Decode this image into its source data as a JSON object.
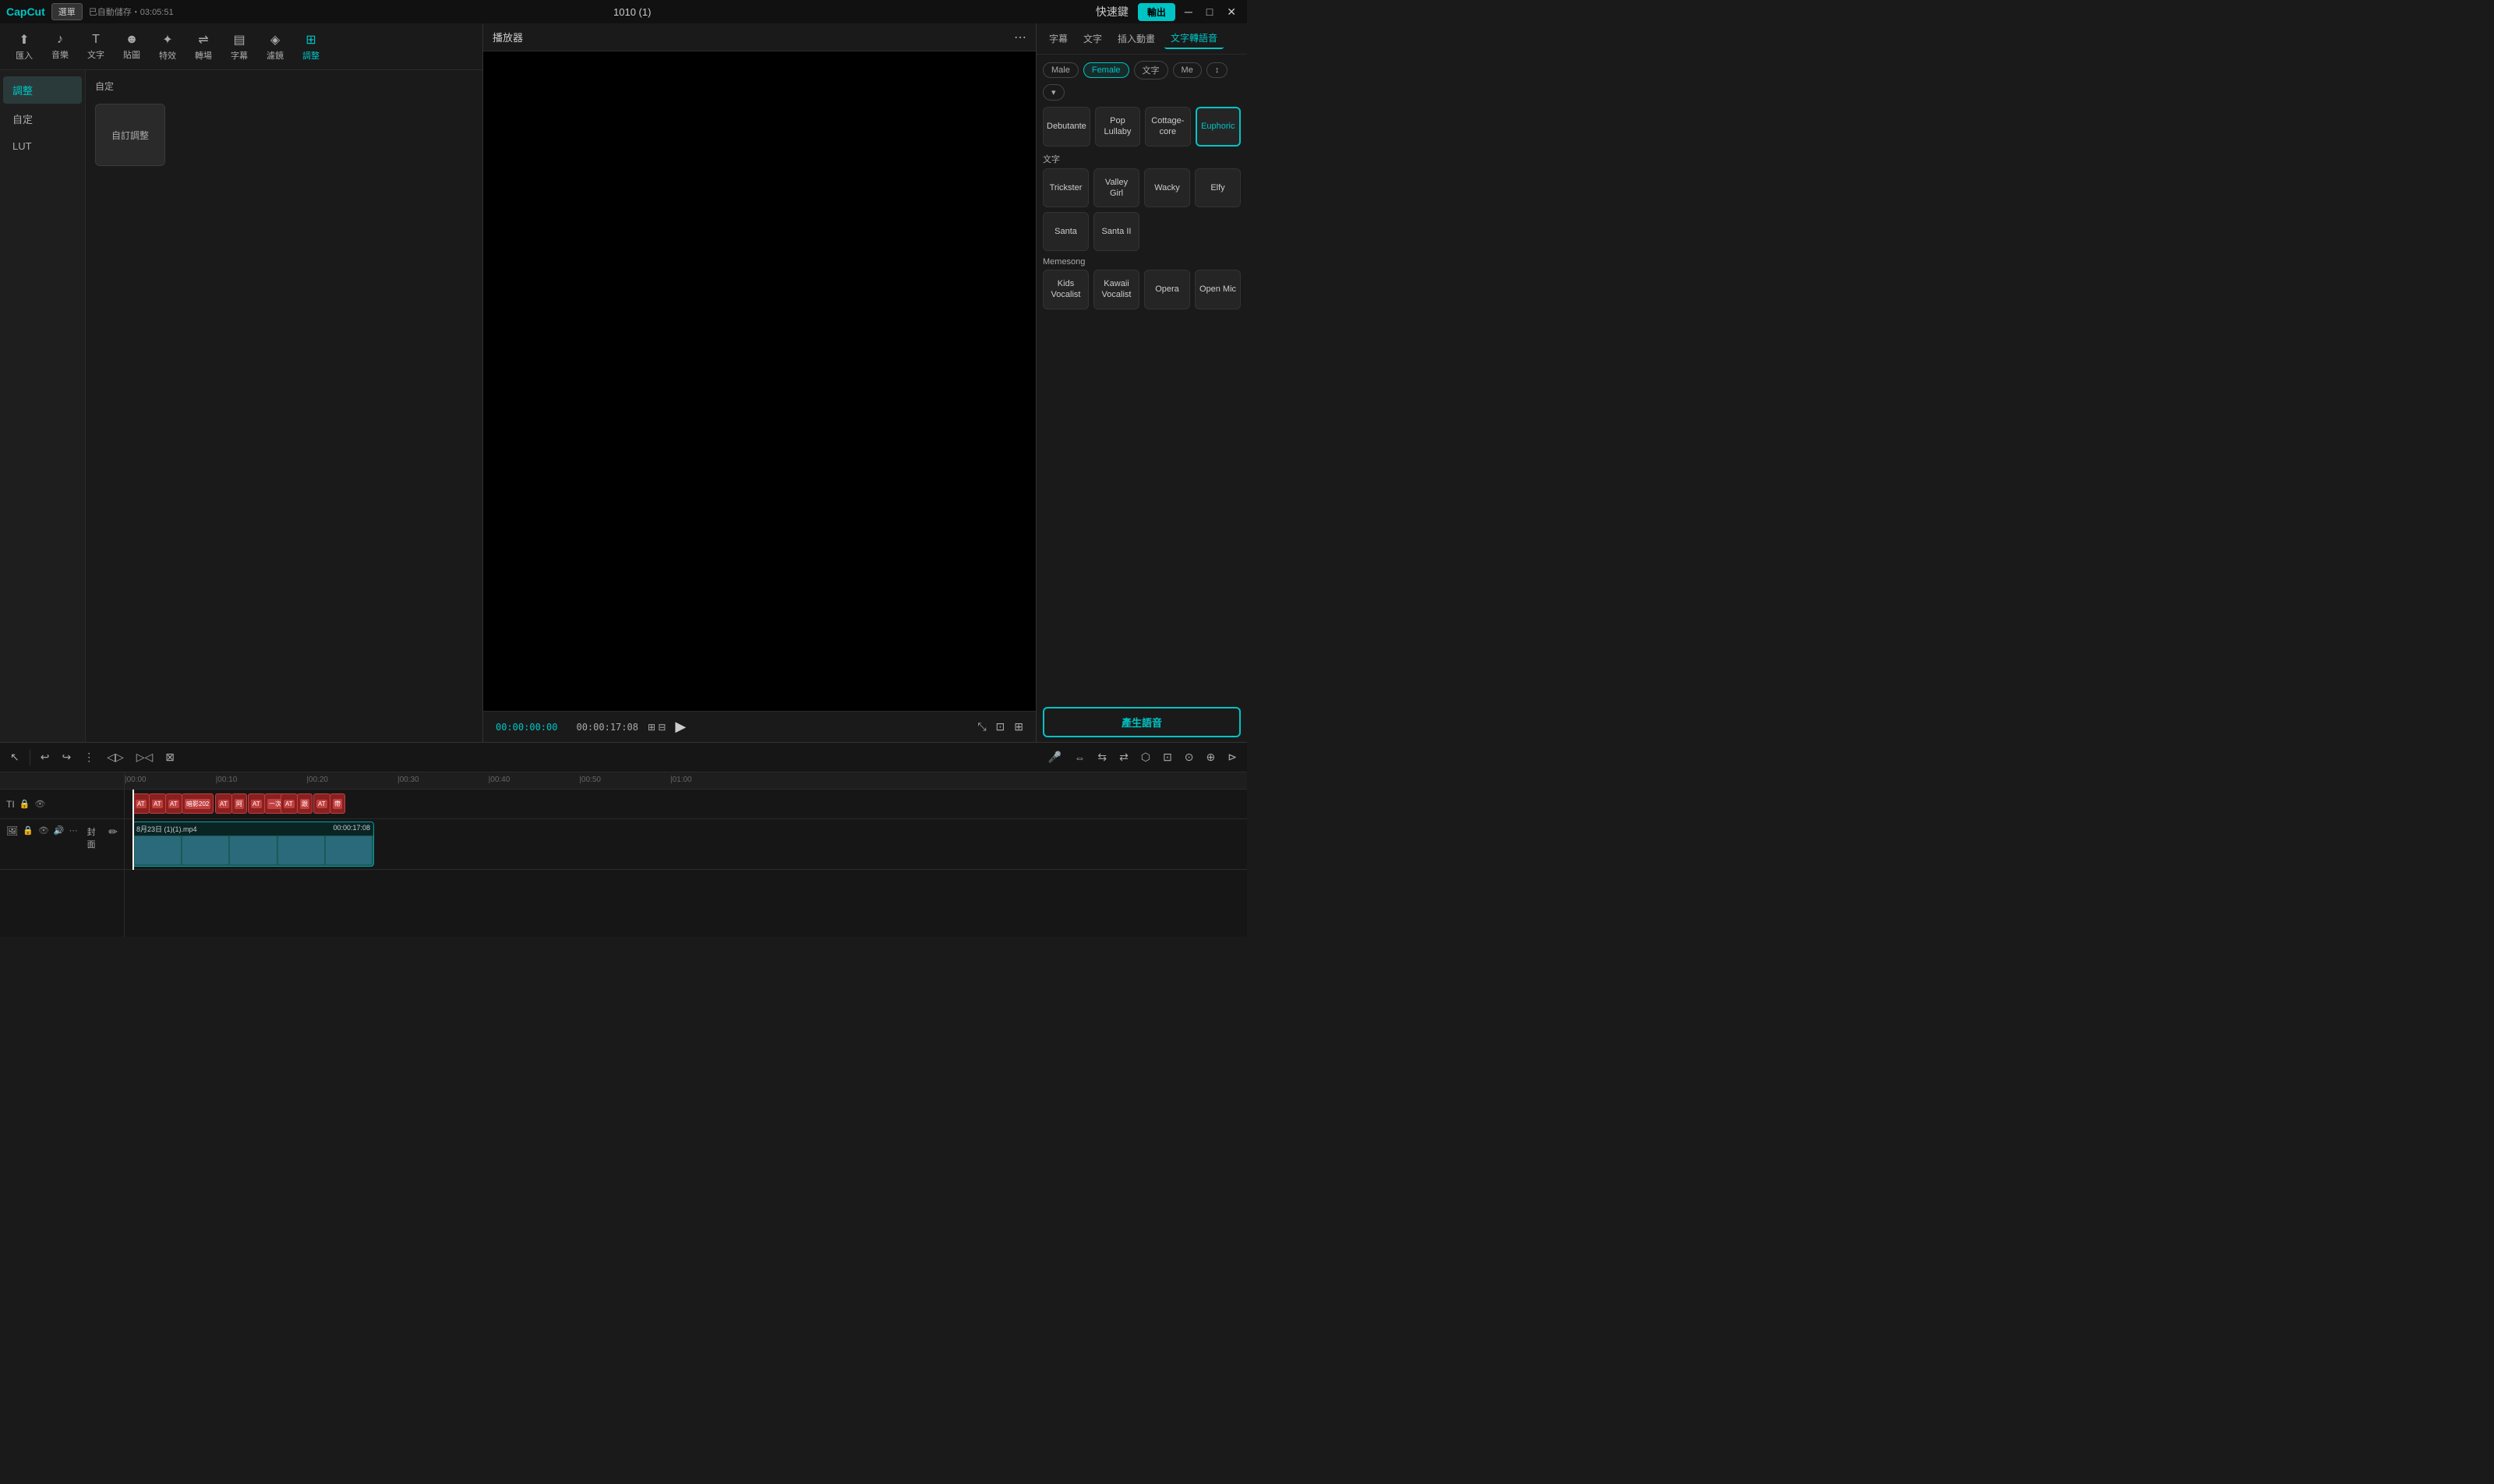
{
  "app": {
    "name": "CapCut",
    "title": "1010 (1)",
    "auto_save": "已自動儲存",
    "time": "03:05:51",
    "select_label": "選單",
    "shortcut_label": "快速鍵",
    "export_label": "輸出"
  },
  "toolbar": {
    "items": [
      {
        "id": "import",
        "icon": "⬆",
        "label": "匯入"
      },
      {
        "id": "music",
        "icon": "♪",
        "label": "音樂"
      },
      {
        "id": "text",
        "icon": "T",
        "label": "文字"
      },
      {
        "id": "sticker",
        "icon": "☻",
        "label": "貼圖"
      },
      {
        "id": "effects",
        "icon": "✦",
        "label": "特效"
      },
      {
        "id": "transition",
        "icon": "⇌",
        "label": "轉場"
      },
      {
        "id": "subtitle",
        "icon": "▤",
        "label": "字幕"
      },
      {
        "id": "filter",
        "icon": "◈",
        "label": "濾鏡"
      },
      {
        "id": "adjust",
        "icon": "⊞",
        "label": "調整"
      }
    ]
  },
  "sidebar": {
    "items": [
      {
        "id": "adjust",
        "label": "調整",
        "active": true
      },
      {
        "id": "custom",
        "label": "自定"
      },
      {
        "id": "lut",
        "label": "LUT"
      }
    ]
  },
  "content": {
    "label": "自定",
    "custom_card_label": "自訂調整"
  },
  "player": {
    "title": "播放器",
    "time_current": "00:00:00:00",
    "time_total": "00:00:17:08"
  },
  "right_panel": {
    "tabs": [
      {
        "id": "subtitle",
        "label": "字幕"
      },
      {
        "id": "text",
        "label": "文字"
      },
      {
        "id": "animation",
        "label": "插入動畫"
      },
      {
        "id": "tts",
        "label": "文字轉語音",
        "active": true
      }
    ],
    "gender_filters": [
      {
        "id": "male",
        "label": "Male"
      },
      {
        "id": "female",
        "label": "Female",
        "active": true
      },
      {
        "id": "text",
        "label": "文字"
      },
      {
        "id": "me",
        "label": "Me"
      },
      {
        "id": "sort",
        "label": "↕"
      },
      {
        "id": "more",
        "label": "▾"
      }
    ],
    "sections": [
      {
        "id": "default",
        "label": "",
        "voices": [
          {
            "id": "debutante",
            "label": "Debutante"
          },
          {
            "id": "pop-lullaby",
            "label": "Pop Lullaby"
          },
          {
            "id": "cottage-core",
            "label": "Cottage-core"
          },
          {
            "id": "euphoric",
            "label": "Euphoric",
            "selected": true
          }
        ]
      },
      {
        "id": "text-section",
        "label": "文字",
        "voices": [
          {
            "id": "trickster",
            "label": "Trickster"
          },
          {
            "id": "valley-girl",
            "label": "Valley Girl"
          },
          {
            "id": "wacky",
            "label": "Wacky"
          },
          {
            "id": "elfy",
            "label": "Elfy"
          },
          {
            "id": "santa",
            "label": "Santa"
          },
          {
            "id": "santa-ii",
            "label": "Santa II"
          }
        ]
      },
      {
        "id": "memesong",
        "label": "Memesong",
        "voices": [
          {
            "id": "kids-vocalist",
            "label": "Kids Vocalist"
          },
          {
            "id": "kawaii-vocalist",
            "label": "Kawaii Vocalist"
          },
          {
            "id": "opera",
            "label": "Opera"
          },
          {
            "id": "open-mic",
            "label": "Open Mic"
          }
        ]
      }
    ],
    "generate_label": "產生語音"
  },
  "timeline": {
    "tools": [
      {
        "id": "select",
        "icon": "↖",
        "label": "select"
      },
      {
        "id": "undo",
        "icon": "↩",
        "label": "undo"
      },
      {
        "id": "redo",
        "icon": "↪",
        "label": "redo"
      },
      {
        "id": "split",
        "icon": "⋮",
        "label": "split"
      },
      {
        "id": "split2",
        "icon": "◁▷",
        "label": "split2"
      },
      {
        "id": "split3",
        "icon": "▷◁",
        "label": "split3"
      },
      {
        "id": "delete",
        "icon": "⊠",
        "label": "delete"
      }
    ],
    "right_tools": [
      {
        "id": "mic",
        "icon": "🎤",
        "label": "mic"
      },
      {
        "id": "t1",
        "icon": "⇔",
        "label": "t1"
      },
      {
        "id": "t2",
        "icon": "⇆",
        "label": "t2"
      },
      {
        "id": "t3",
        "icon": "⇄",
        "label": "t3"
      },
      {
        "id": "t4",
        "icon": "⬡",
        "label": "t4"
      },
      {
        "id": "t5",
        "icon": "⊡",
        "label": "t5"
      },
      {
        "id": "t6",
        "icon": "⊙",
        "label": "t6"
      },
      {
        "id": "t7",
        "icon": "⊕",
        "label": "t7"
      },
      {
        "id": "end-marker",
        "icon": "⊳",
        "label": "end-marker"
      }
    ],
    "ruler_marks": [
      "00:00",
      "00:10",
      "00:20",
      "00:30",
      "00:40",
      "00:50",
      "01:00"
    ],
    "tracks": [
      {
        "id": "subtitle-track",
        "type": "subtitle",
        "icons": [
          "TI",
          "🔒",
          "👁"
        ],
        "clips": [
          {
            "id": "c1",
            "text": "AT"
          },
          {
            "id": "c2",
            "text": "AT"
          },
          {
            "id": "c3",
            "text": "AT"
          },
          {
            "id": "c4",
            "text": "暗影202"
          },
          {
            "id": "c5",
            "text": "AT"
          },
          {
            "id": "c6",
            "text": "阿"
          },
          {
            "id": "c7",
            "text": "AT"
          },
          {
            "id": "c8",
            "text": "一次"
          },
          {
            "id": "c9",
            "text": "AT"
          },
          {
            "id": "c10",
            "text": "跟"
          },
          {
            "id": "c11",
            "text": "AT"
          },
          {
            "id": "c12",
            "text": "帶"
          }
        ]
      },
      {
        "id": "video-track",
        "type": "video",
        "icons": [
          "🖼",
          "🔒",
          "👁",
          "🔊",
          "⋯"
        ],
        "clip": {
          "label": "8月23日 (1)(1).mp4",
          "duration": "00:00:17:08",
          "cover_label": "封面"
        }
      }
    ]
  }
}
